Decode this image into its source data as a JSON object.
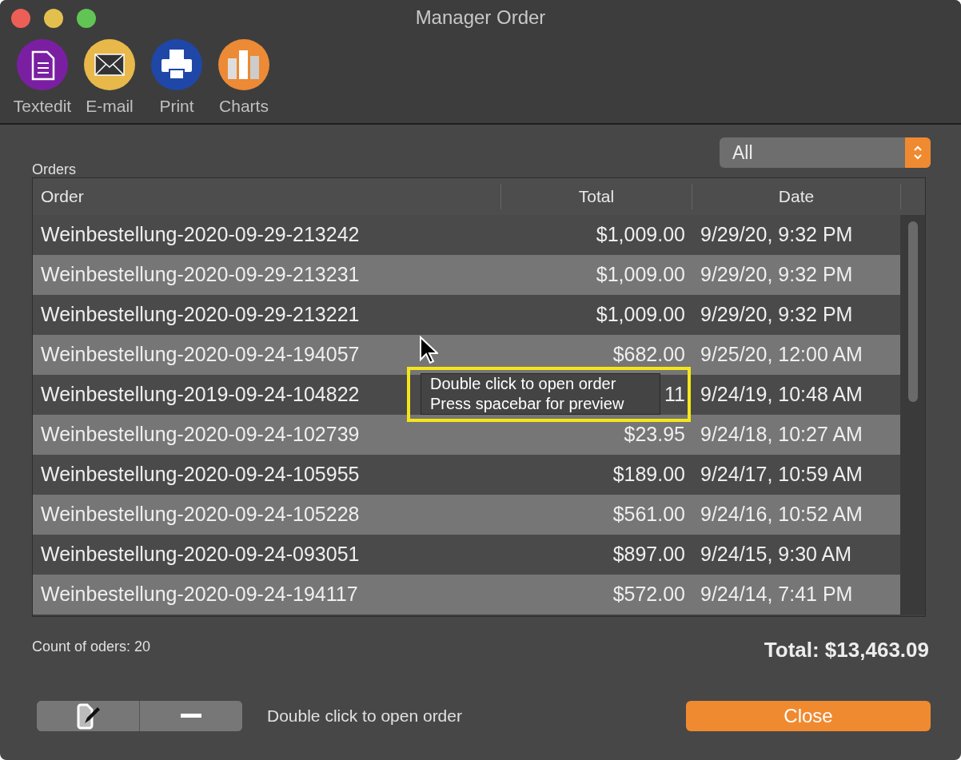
{
  "window": {
    "title": "Manager Order"
  },
  "toolbar": [
    {
      "kind": "textedit",
      "label": "Textedit"
    },
    {
      "kind": "email",
      "label": "E-mail"
    },
    {
      "kind": "print",
      "label": "Print"
    },
    {
      "kind": "charts",
      "label": "Charts"
    }
  ],
  "filter": {
    "value": "All"
  },
  "orders_label": "Orders",
  "table": {
    "columns": [
      "Order",
      "Total",
      "Date"
    ],
    "rows": [
      {
        "order": "Weinbestellung-2020-09-29-213242",
        "total": "$1,009.00",
        "date": "9/29/20, 9:32 PM"
      },
      {
        "order": "Weinbestellung-2020-09-29-213231",
        "total": "$1,009.00",
        "date": "9/29/20, 9:32 PM"
      },
      {
        "order": "Weinbestellung-2020-09-29-213221",
        "total": "$1,009.00",
        "date": "9/29/20, 9:32 PM"
      },
      {
        "order": "Weinbestellung-2020-09-24-194057",
        "total": "$682.00",
        "date": "9/25/20, 12:00 AM"
      },
      {
        "order": "Weinbestellung-2019-09-24-104822",
        "total": "11",
        "date": "9/24/19, 10:48 AM"
      },
      {
        "order": "Weinbestellung-2020-09-24-102739",
        "total": "$23.95",
        "date": "9/24/18, 10:27 AM"
      },
      {
        "order": "Weinbestellung-2020-09-24-105955",
        "total": "$189.00",
        "date": "9/24/17, 10:59 AM"
      },
      {
        "order": "Weinbestellung-2020-09-24-105228",
        "total": "$561.00",
        "date": "9/24/16, 10:52 AM"
      },
      {
        "order": "Weinbestellung-2020-09-24-093051",
        "total": "$897.00",
        "date": "9/24/15, 9:30 AM"
      },
      {
        "order": "Weinbestellung-2020-09-24-194117",
        "total": "$572.00",
        "date": "9/24/14, 7:41 PM"
      }
    ]
  },
  "tooltip": {
    "lines": [
      "Double click to open order",
      "Press spacebar for preview"
    ]
  },
  "count": "Count of oders: 20",
  "grand_total": "Total: $13,463.09",
  "hint": "Double click to open order",
  "close_button": "Close"
}
